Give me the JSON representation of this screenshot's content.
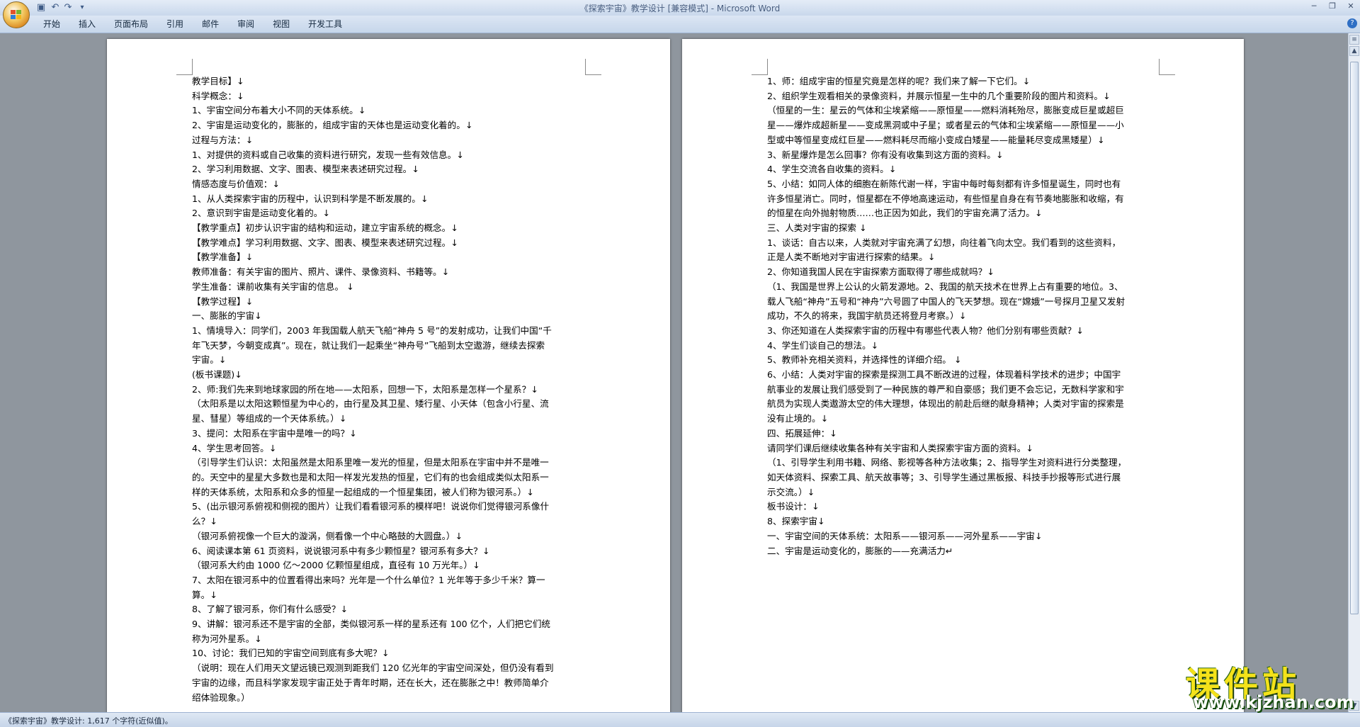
{
  "window": {
    "title": "《探索宇宙》教学设计 [兼容模式] - Microsoft Word",
    "controls": [
      "─",
      "❐",
      "✕"
    ]
  },
  "quick_access": {
    "save_icon": "save-icon",
    "undo_icon": "undo-icon",
    "redo_icon": "redo-icon"
  },
  "ribbon": {
    "tabs": [
      "开始",
      "插入",
      "页面布局",
      "引用",
      "邮件",
      "审阅",
      "视图",
      "开发工具"
    ],
    "help": "?"
  },
  "page1": {
    "lines": [
      "教学目标】↓",
      "科学概念：↓",
      "1、宇宙空间分布着大小不同的天体系统。↓",
      "2、宇宙是运动变化的，膨胀的，组成宇宙的天体也是运动变化着的。↓",
      "过程与方法：↓",
      "1、对提供的资料或自己收集的资料进行研究，发现一些有效信息。↓",
      "2、学习利用数据、文字、图表、模型来表述研究过程。↓",
      "情感态度与价值观：↓",
      "1、从人类探索宇宙的历程中，认识到科学是不断发展的。↓",
      "2、意识到宇宙是运动变化着的。↓",
      "【教学重点】初步认识宇宙的结构和运动，建立宇宙系统的概念。↓",
      "【教学难点】学习利用数据、文字、图表、模型来表述研究过程。↓",
      "【教学准备】↓",
      "教师准备：有关宇宙的图片、照片、课件、录像资料、书籍等。↓",
      "学生准备：课前收集有关宇宙的信息。 ↓",
      "【教学过程】↓",
      "一、膨胀的宇宙↓",
      "1、情境导入：同学们，2003 年我国载人航天飞船“神舟 5 号”的发射成功，让我们中国“千",
      "年飞天梦，今朝变成真”。现在，就让我们一起乘坐“神舟号”飞船到太空遨游，继续去探索",
      "宇宙。↓",
      "(板书课题)↓",
      "2、师:我们先来到地球家园的所在地——太阳系，回想一下，太阳系是怎样一个星系？↓",
      "（太阳系是以太阳这颗恒星为中心的，由行星及其卫星、矮行星、小天体（包含小行星、流",
      "星、彗星）等组成的一个天体系统。）↓",
      "3、提问：太阳系在宇宙中是唯一的吗？↓",
      "4、学生思考回答。↓",
      "（引导学生们认识：太阳虽然是太阳系里唯一发光的恒星，但是太阳系在宇宙中并不是唯一",
      "的。天空中的星星大多数也是和太阳一样发光发热的恒星，它们有的也会组成类似太阳系一",
      "样的天体系统，太阳系和众多的恒星一起组成的一个恒星集团，被人们称为银河系。）↓",
      "5、(出示银河系俯视和侧视的图片）让我们看看银河系的模样吧！说说你们觉得银河系像什",
      "么？↓",
      "（银河系俯视像一个巨大的漩涡，侧看像一个中心略鼓的大圆盘。）↓",
      "6、阅读课本第 61 页资料，说说银河系中有多少颗恒星？银河系有多大？↓",
      "（银河系大约由 1000 亿～2000 亿颗恒星组成，直径有 10 万光年。）↓",
      "7、太阳在银河系中的位置看得出来吗？光年是一个什么单位？1 光年等于多少千米？算一",
      "算。↓",
      "8、了解了银河系，你们有什么感受？↓",
      "9、讲解：银河系还不是宇宙的全部，类似银河系一样的星系还有 100 亿个，人们把它们统",
      "称为河外星系。↓",
      "10、讨论：我们已知的宇宙空间到底有多大呢？↓",
      "（说明：现在人们用天文望远镜已观测到距我们 120 亿光年的宇宙空间深处，但仍没有看到",
      "宇宙的边缘，而且科学家发现宇宙正处于青年时期，还在长大，还在膨胀之中！教师简单介",
      "绍体验现象。）"
    ]
  },
  "page2": {
    "lines": [
      "1、师：组成宇宙的恒星究竟是怎样的呢？我们来了解一下它们。↓",
      "2、组织学生观看相关的录像资料，并展示恒星一生中的几个重要阶段的图片和资料。↓",
      "（恒星的一生：星云的气体和尘埃紧缩——原恒星——燃料消耗殆尽，膨胀变成巨星或超巨",
      "星——爆炸成超新星——变成黑洞或中子星；或者星云的气体和尘埃紧缩——原恒星——小",
      "型或中等恒星变成红巨星——燃料耗尽而缩小变成白矮星——能量耗尽变成黑矮星）↓",
      "3、新星爆炸是怎么回事？你有没有收集到这方面的资料。↓",
      "4、学生交流各自收集的资料。↓",
      "5、小结：如同人体的细胞在新陈代谢一样，宇宙中每时每刻都有许多恒星诞生，同时也有",
      "许多恒星消亡。同时，恒星都在不停地高速运动，有些恒星自身在有节奏地膨胀和收缩，有",
      "的恒星在向外抛射物质……也正因为如此，我们的宇宙充满了活力。↓",
      "三、人类对宇宙的探索 ↓",
      "1、谈话：自古以来，人类就对宇宙充满了幻想，向往着飞向太空。我们看到的这些资料，",
      "正是人类不断地对宇宙进行探索的结果。↓",
      "2、你知道我国人民在宇宙探索方面取得了哪些成就吗？↓",
      "（1、我国是世界上公认的火箭发源地。2、我国的航天技术在世界上占有重要的地位。3、",
      "载人飞船“神舟”五号和“神舟”六号圆了中国人的飞天梦想。现在“嫦娥”一号探月卫星又发射",
      "成功，不久的将来，我国宇航员还将登月考察。）↓",
      "3、你还知道在人类探索宇宙的历程中有哪些代表人物？他们分别有哪些贡献？↓",
      "4、学生们谈自己的想法。↓",
      "5、教师补充相关资料，并选择性的详细介绍。 ↓",
      "6、小结：人类对宇宙的探索是探测工具不断改进的过程，体现着科学技术的进步；中国宇",
      "航事业的发展让我们感受到了一种民族的尊严和自豪感；我们更不会忘记，无数科学家和宇",
      "航员为实现人类遨游太空的伟大理想，体现出的前赴后继的献身精神；人类对宇宙的探索是",
      "没有止境的。↓",
      "四、拓展延伸：↓",
      "请同学们课后继续收集各种有关宇宙和人类探索宇宙方面的资料。↓",
      "（1、引导学生利用书籍、网络、影视等各种方法收集；2、指导学生对资料进行分类整理，",
      "如天体资料、探索工具、航天故事等；3、引导学生通过黑板报、科技手抄报等形式进行展",
      "示交流。）↓",
      "板书设计：↓",
      "8、探索宇宙↓",
      "一、宇宙空间的天体系统：太阳系——银河系——河外星系——宇宙↓",
      "二、宇宙是运动变化的，膨胀的——充满活力↵"
    ]
  },
  "status_bar": {
    "text": "《探索宇宙》教学设计: 1,617 个字符(近似值)。"
  },
  "watermark": {
    "brand": "课件站",
    "url": "www.kjzhan.com"
  }
}
